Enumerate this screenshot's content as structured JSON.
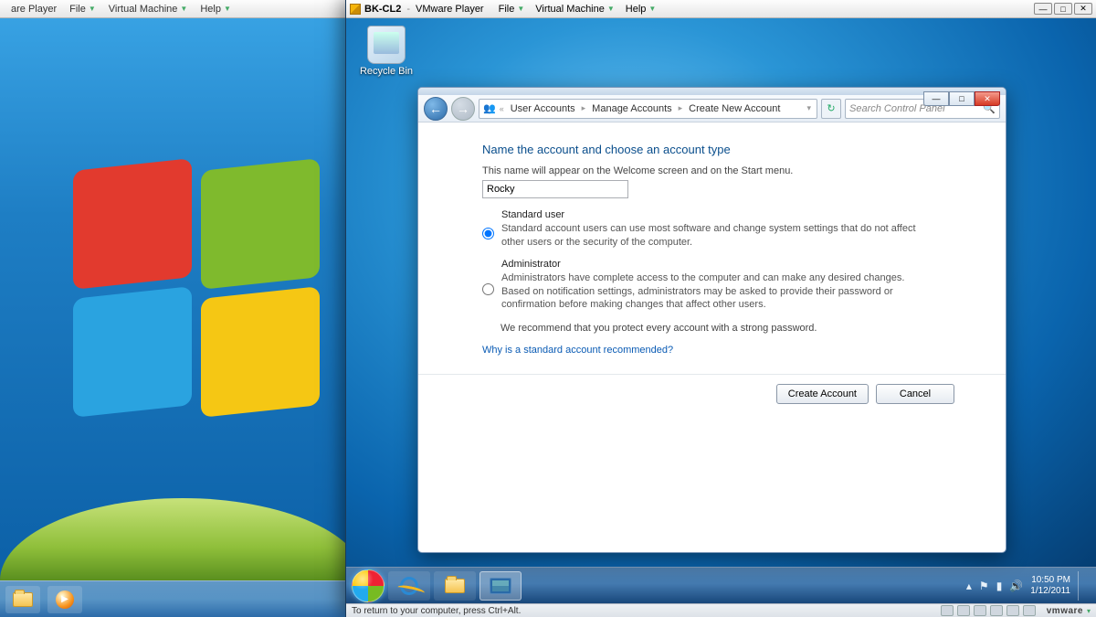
{
  "outer_vm": {
    "menubar": {
      "title_suffix": "are Player",
      "items": [
        "File",
        "Virtual Machine",
        "Help"
      ]
    },
    "taskbar_icons": [
      "folder-icon",
      "wmp-icon"
    ]
  },
  "front_vm": {
    "titlebar": {
      "vm_name": "BK-CL2",
      "app_name": "VMware Player",
      "menus": [
        "File",
        "Virtual Machine",
        "Help"
      ]
    },
    "desktop": {
      "recycle_bin_label": "Recycle Bin"
    },
    "control_panel": {
      "breadcrumb": [
        "User Accounts",
        "Manage Accounts",
        "Create New Account"
      ],
      "search_placeholder": "Search Control Panel",
      "heading": "Name the account and choose an account type",
      "subheading": "This name will appear on the Welcome screen and on the Start menu.",
      "account_name_value": "Rocky",
      "options": {
        "standard": {
          "label": "Standard user",
          "desc": "Standard account users can use most software and change system settings that do not affect other users or the security of the computer.",
          "selected": true
        },
        "admin": {
          "label": "Administrator",
          "desc": "Administrators have complete access to the computer and can make any desired changes. Based on notification settings, administrators may be asked to provide their password or confirmation before making changes that affect other users.",
          "selected": false
        }
      },
      "recommend_text": "We recommend that you protect every account with a strong password.",
      "help_link": "Why is a standard account recommended?",
      "create_button": "Create Account",
      "cancel_button": "Cancel"
    },
    "taskbar": {
      "pinned": [
        "start-orb",
        "ie-icon",
        "folder-icon",
        "control-panel-icon"
      ],
      "active": "control-panel-icon",
      "tray_icons": [
        "show-hidden-icon",
        "action-center-icon",
        "network-icon",
        "volume-icon"
      ],
      "clock_time": "10:50 PM",
      "clock_date": "1/12/2011"
    },
    "statusbar": {
      "hint": "To return to your computer, press Ctrl+Alt.",
      "device_count": 6,
      "brand": "vmware"
    }
  }
}
